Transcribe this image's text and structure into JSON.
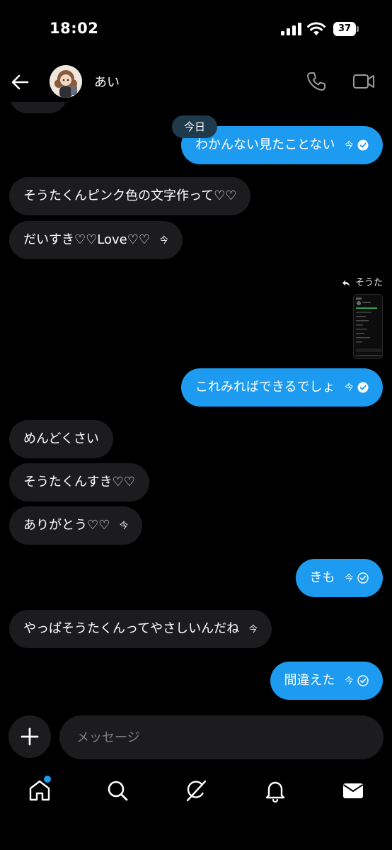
{
  "status_bar": {
    "time": "18:02",
    "battery": "37"
  },
  "header": {
    "contact_name": "あい"
  },
  "date_label": "今日",
  "reply_label": "そうた",
  "messages": [
    {
      "text": "わかんない見たことない",
      "seen": "今",
      "direction": "out"
    },
    {
      "text": "そうたくんピンク色の文字作って♡♡",
      "direction": "in"
    },
    {
      "text": "だいすき♡♡Love♡♡",
      "seen": "今",
      "direction": "in"
    },
    {
      "text": "これみればできるでしょ",
      "seen": "今",
      "direction": "out"
    },
    {
      "text": "めんどくさい",
      "direction": "in"
    },
    {
      "text": "そうたくんすき♡♡",
      "direction": "in"
    },
    {
      "text": "ありがとう♡♡",
      "seen": "今",
      "direction": "in"
    },
    {
      "text": "きも",
      "seen": "今",
      "direction": "out"
    },
    {
      "text": "やっぱそうたくんってやさしいんだね",
      "seen": "今",
      "direction": "in"
    },
    {
      "text": "間違えた",
      "seen": "今",
      "direction": "out"
    }
  ],
  "composer": {
    "placeholder": "メッセージ"
  },
  "icons": [
    "back-icon",
    "phone-icon",
    "video-icon",
    "reply-icon",
    "check-icon",
    "plus-icon",
    "home-icon",
    "search-icon",
    "grok-icon",
    "bell-icon",
    "mail-icon"
  ],
  "colors": {
    "accent": "#1d9bf0",
    "incoming_bubble": "#1c1c1e",
    "date_pill": "#1e3a4b"
  }
}
